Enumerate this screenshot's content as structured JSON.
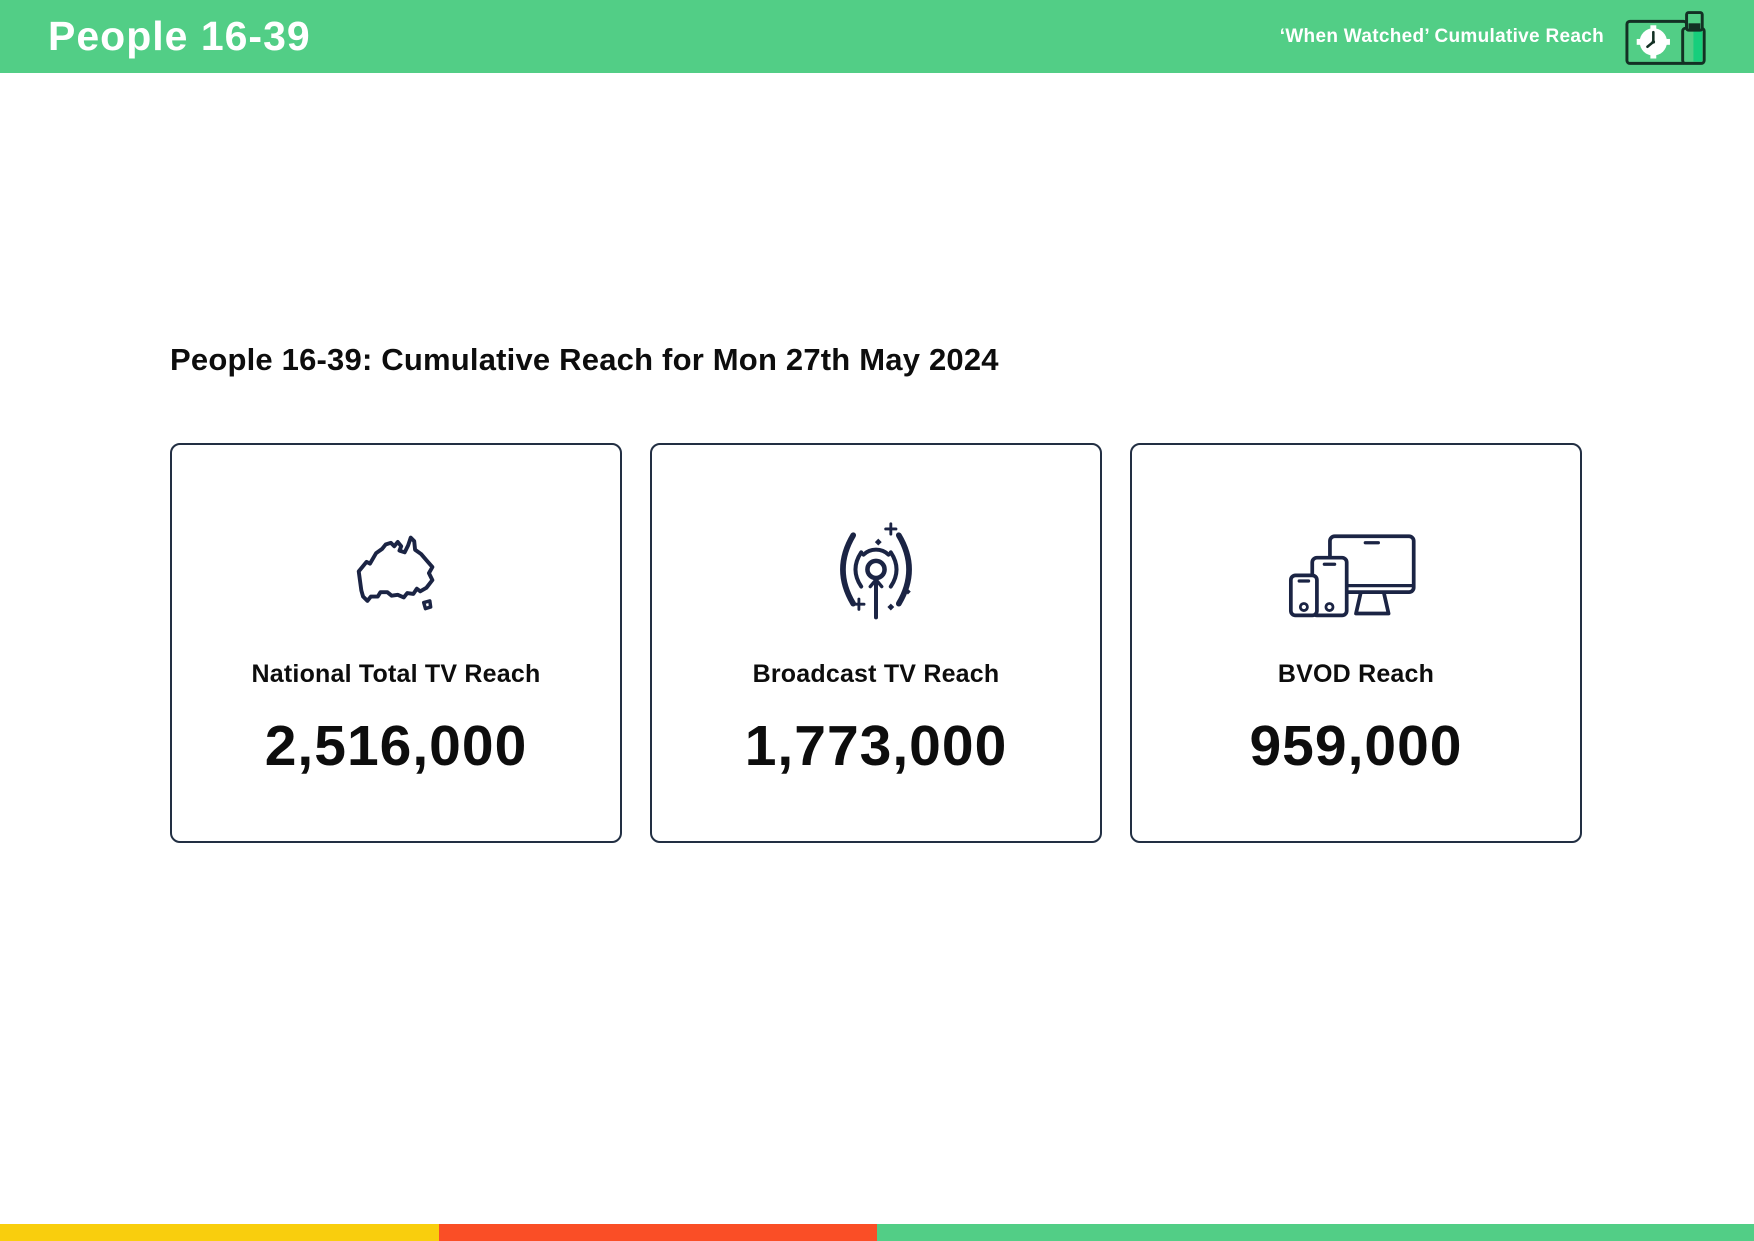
{
  "header": {
    "title": "People 16-39",
    "subtitle": "‘When Watched’ Cumulative Reach",
    "logo_icon": "clock-device-icon"
  },
  "main": {
    "section_title": "People 16-39: Cumulative Reach for Mon 27th May 2024",
    "cards": [
      {
        "icon": "australia-map-icon",
        "label": "National Total TV Reach",
        "value": "2,516,000"
      },
      {
        "icon": "broadcast-antenna-icon",
        "label": "Broadcast TV Reach",
        "value": "1,773,000"
      },
      {
        "icon": "screens-devices-icon",
        "label": "BVOD Reach",
        "value": "959,000"
      }
    ]
  },
  "footer": {
    "segments": [
      {
        "color": "#F9CE0D",
        "width_pct": 25
      },
      {
        "color": "#FA4E26",
        "width_pct": 25
      },
      {
        "color": "#52CE86",
        "width_pct": 50
      }
    ]
  },
  "colors": {
    "accent_green": "#52CE86",
    "bright_green": "#17CE7C",
    "icon_navy": "#1B2444",
    "card_border": "#222F43",
    "text_dark": "#0D0D0D",
    "logo_dark": "#133024"
  }
}
